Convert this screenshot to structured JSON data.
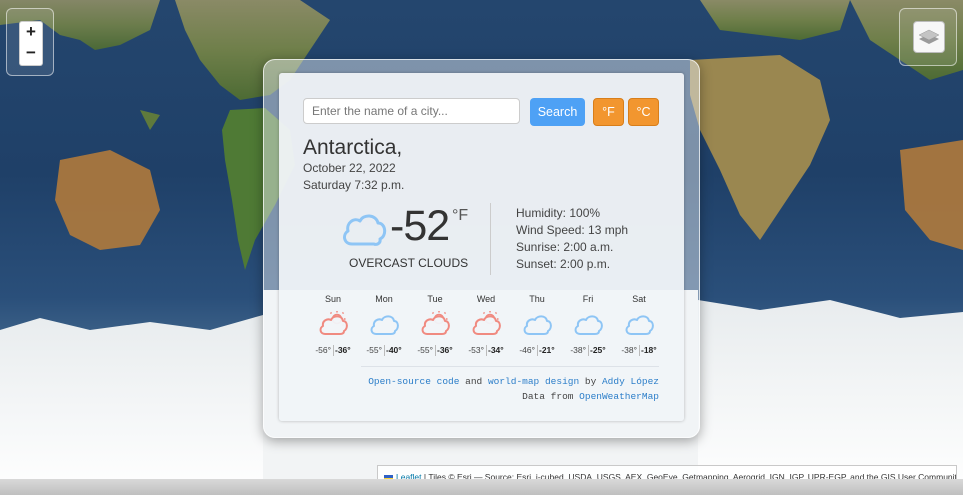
{
  "map": {
    "zoom_in_label": "+",
    "zoom_out_label": "−",
    "attribution": {
      "leaflet_link": "Leaflet",
      "text": "| Tiles © Esri — Source: Esri, i-cubed, USDA, USGS, AEX, GeoEye, Getmapping, Aerogrid, IGN, IGP, UPR-EGP, and the GIS User Community"
    }
  },
  "search": {
    "placeholder": "Enter the name of a city...",
    "value": "",
    "search_label": "Search",
    "fahrenheit_label": "°F",
    "celsius_label": "°C"
  },
  "current": {
    "city": "Antarctica,",
    "date": "October 22, 2022",
    "day_time": "Saturday 7:32 p.m.",
    "temperature": "-52",
    "unit": "°F",
    "description": "OVERCAST CLOUDS",
    "icon": "cloud-icon",
    "humidity": "Humidity: 100%",
    "wind": "Wind Speed: 13 mph",
    "sunrise": "Sunrise: 2:00 a.m.",
    "sunset": "Sunset: 2:00 p.m."
  },
  "forecast": [
    {
      "day": "Sun",
      "icon": "sun-cloud-icon",
      "low": "-56°",
      "high": "-36°"
    },
    {
      "day": "Mon",
      "icon": "cloud-icon",
      "low": "-55°",
      "high": "-40°"
    },
    {
      "day": "Tue",
      "icon": "sun-cloud-icon",
      "low": "-55°",
      "high": "-36°"
    },
    {
      "day": "Wed",
      "icon": "sun-cloud-icon",
      "low": "-53°",
      "high": "-34°"
    },
    {
      "day": "Thu",
      "icon": "cloud-icon",
      "low": "-46°",
      "high": "-21°"
    },
    {
      "day": "Fri",
      "icon": "cloud-icon",
      "low": "-38°",
      "high": "-25°"
    },
    {
      "day": "Sat",
      "icon": "cloud-icon",
      "low": "-38°",
      "high": "-18°"
    }
  ],
  "credits": {
    "open_source": "Open-source code",
    "and": "and",
    "world_map": "world-map design",
    "by": "by",
    "author": "Addy López",
    "data_from": "Data from",
    "owm": "OpenWeatherMap"
  },
  "colors": {
    "search_button": "#4ea1f5",
    "unit_buttons": "#f2962f",
    "cloud_icon": "#8ec5f5",
    "sun_icon": "#f08a80",
    "link": "#2c7ec9"
  }
}
